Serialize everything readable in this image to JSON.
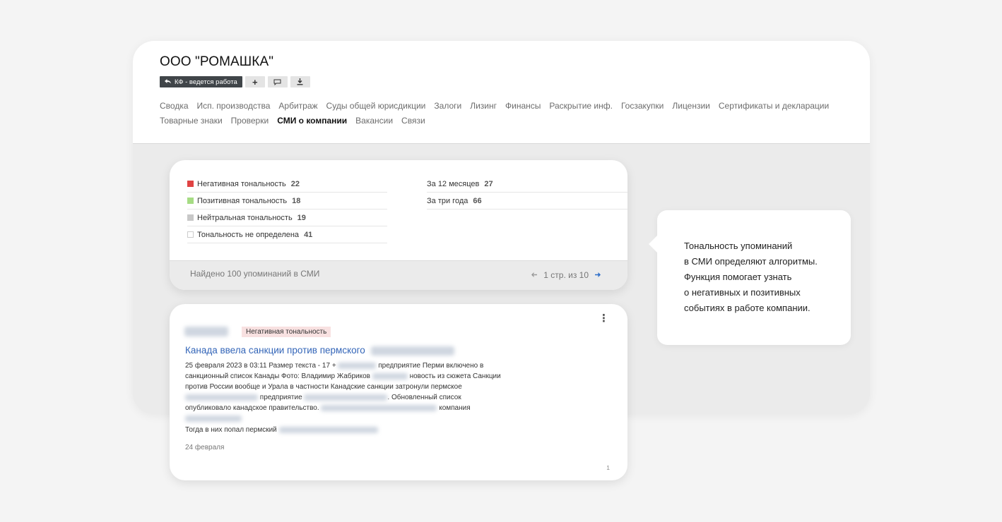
{
  "header": {
    "company_name": "ООО \"РОМАШКА\"",
    "status_label": "КФ - ведется работа",
    "add_label": "+"
  },
  "nav": {
    "items": [
      {
        "label": "Сводка"
      },
      {
        "label": "Исп. производства"
      },
      {
        "label": "Арбитраж"
      },
      {
        "label": "Суды общей юрисдикции"
      },
      {
        "label": "Залоги"
      },
      {
        "label": "Лизинг"
      },
      {
        "label": "Финансы"
      },
      {
        "label": "Раскрытие инф."
      },
      {
        "label": "Госзакупки"
      },
      {
        "label": "Лицензии"
      },
      {
        "label": "Сертификаты и декларации"
      },
      {
        "label": "Товарные знаки"
      },
      {
        "label": "Проверки"
      },
      {
        "label": "СМИ о компании",
        "active": true
      },
      {
        "label": "Вакансии"
      },
      {
        "label": "Связи"
      }
    ]
  },
  "stats": {
    "tonality": [
      {
        "label": "Негативная тональность",
        "count": "22",
        "color": "#e04343"
      },
      {
        "label": "Позитивная тональность",
        "count": "18",
        "color": "#a6dc84"
      },
      {
        "label": "Нейтральная тональность",
        "count": "19",
        "color": "#c8c8c8"
      },
      {
        "label": "Тональность не определена",
        "count": "41",
        "color": "#ffffff"
      }
    ],
    "periods": [
      {
        "label": "За 12 месяцев",
        "count": "27"
      },
      {
        "label": "За три года",
        "count": "66"
      }
    ],
    "found_text": "Найдено 100 упоминаний в СМИ",
    "pager_text": "1 стр. из 10",
    "prev_icon": "arrow-left-icon",
    "next_icon": "arrow-right-icon"
  },
  "news": {
    "badge": "Негативная тональность",
    "title": "Канада ввела санкции против пермского",
    "body": {
      "l1a": "25 февраля 2023 в 03:11 Размер текста - 17 +",
      "l1b": "предприятие Перми включено в",
      "l2a": "санкционный список Канады Фото: Владимир Жабриков",
      "l2b": "новость из сюжета Санкции",
      "l3": "против России вообще и Урала в частности Канадские санкции затронули пермское",
      "l4a": "предприятие",
      "l4b": ". Обновленный список",
      "l5a": "опубликовало канадское правительство.",
      "l5b": "компания"
    },
    "extra": "Тогда в них попал пермский",
    "date": "24 февраля",
    "count": "1"
  },
  "tooltip": {
    "lines": [
      "Тональность упоминаний",
      "в СМИ определяют алгоритмы.",
      "Функция помогает узнать",
      "о негативных и позитивных",
      "событиях в работе компании."
    ]
  }
}
